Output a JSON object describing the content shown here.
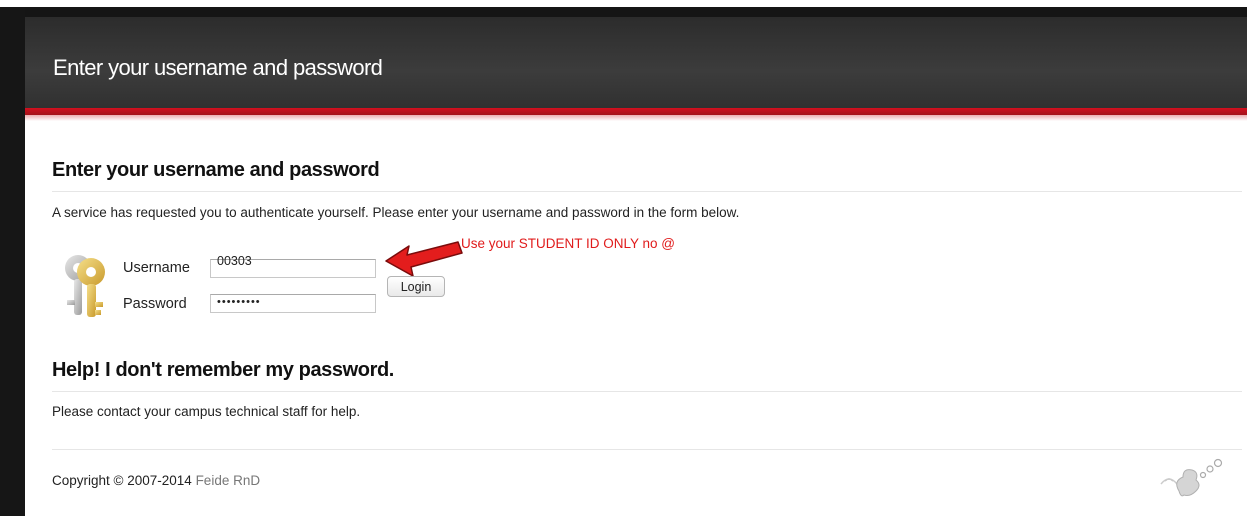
{
  "header": {
    "title": "Enter your username and password"
  },
  "main": {
    "heading": "Enter your username and password",
    "intro": "A service has requested you to authenticate yourself. Please enter your username and password in the form below.",
    "form": {
      "username_label": "Username",
      "username_value": "00303",
      "password_label": "Password",
      "password_value": "•••••••••",
      "login_label": "Login"
    },
    "annotation": "Use your STUDENT ID ONLY no @"
  },
  "help": {
    "heading": "Help! I don't remember my password.",
    "text": "Please contact your campus technical staff for help."
  },
  "footer": {
    "copyright": "Copyright © 2007-2014",
    "link": "Feide RnD"
  },
  "icons": {
    "keys": "keys-icon",
    "logo": "feide-logo-icon",
    "arrow": "red-arrow-icon"
  },
  "colors": {
    "accent": "#d20f1e",
    "header": "#333333",
    "annotation": "#e01b1b"
  }
}
